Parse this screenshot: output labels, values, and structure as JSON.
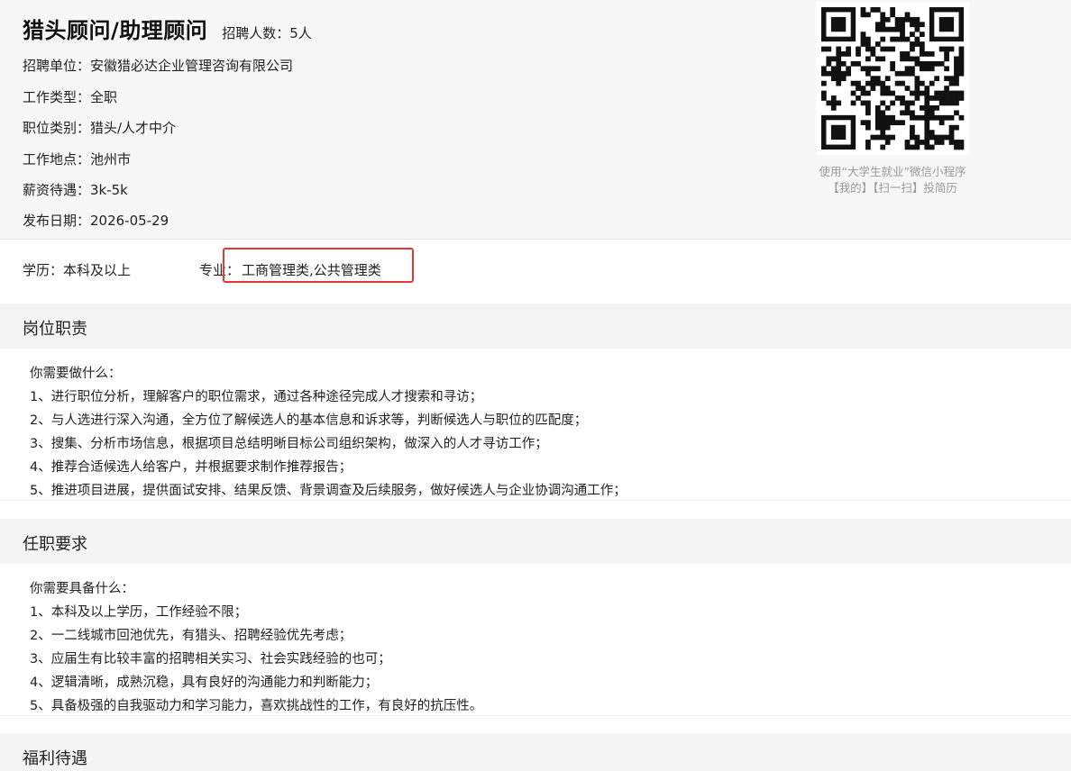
{
  "job": {
    "title": "猎头顾问/助理顾问",
    "headcount": "招聘人数：5人",
    "company": "招聘单位：安徽猎必达企业管理咨询有限公司",
    "job_type": "工作类型：全职",
    "category": "职位类别：猎头/人才中介",
    "location": "工作地点：池州市",
    "salary": "薪资待遇：3k-5k",
    "publish_date": "发布日期：2026-05-29"
  },
  "qr": {
    "caption_line1": "使用“大学生就业”微信小程序",
    "caption_line2": "【我的】【扫一扫】投简历"
  },
  "requirements_row": {
    "education": "学历：本科及以上",
    "major_label": "专业：",
    "major_value": "工商管理类,公共管理类",
    "highlight_color": "#e53935"
  },
  "sections": {
    "duties": {
      "heading": "岗位职责",
      "lines": [
        "你需要做什么：",
        "1、进行职位分析，理解客户的职位需求，通过各种途径完成人才搜索和寻访；",
        "2、与人选进行深入沟通，全方位了解候选人的基本信息和诉求等，判断候选人与职位的匹配度；",
        "3、搜集、分析市场信息，根据项目总结明晰目标公司组织架构，做深入的人才寻访工作；",
        "4、推荐合适候选人给客户，并根据要求制作推荐报告；",
        "5、推进项目进展，提供面试安排、结果反馈、背景调查及后续服务，做好候选人与企业协调沟通工作；"
      ]
    },
    "qualifications": {
      "heading": "任职要求",
      "lines": [
        "你需要具备什么：",
        "1、本科及以上学历，工作经验不限；",
        "2、一二线城市回池优先，有猎头、招聘经验优先考虑；",
        "3、应届生有比较丰富的招聘相关实习、社会实践经验的也可；",
        "4、逻辑清晰，成熟沉稳，具有良好的沟通能力和判断能力；",
        "5、具备极强的自我驱动力和学习能力，喜欢挑战性的工作，有良好的抗压性。"
      ]
    },
    "benefits": {
      "heading": "福利待遇"
    }
  }
}
